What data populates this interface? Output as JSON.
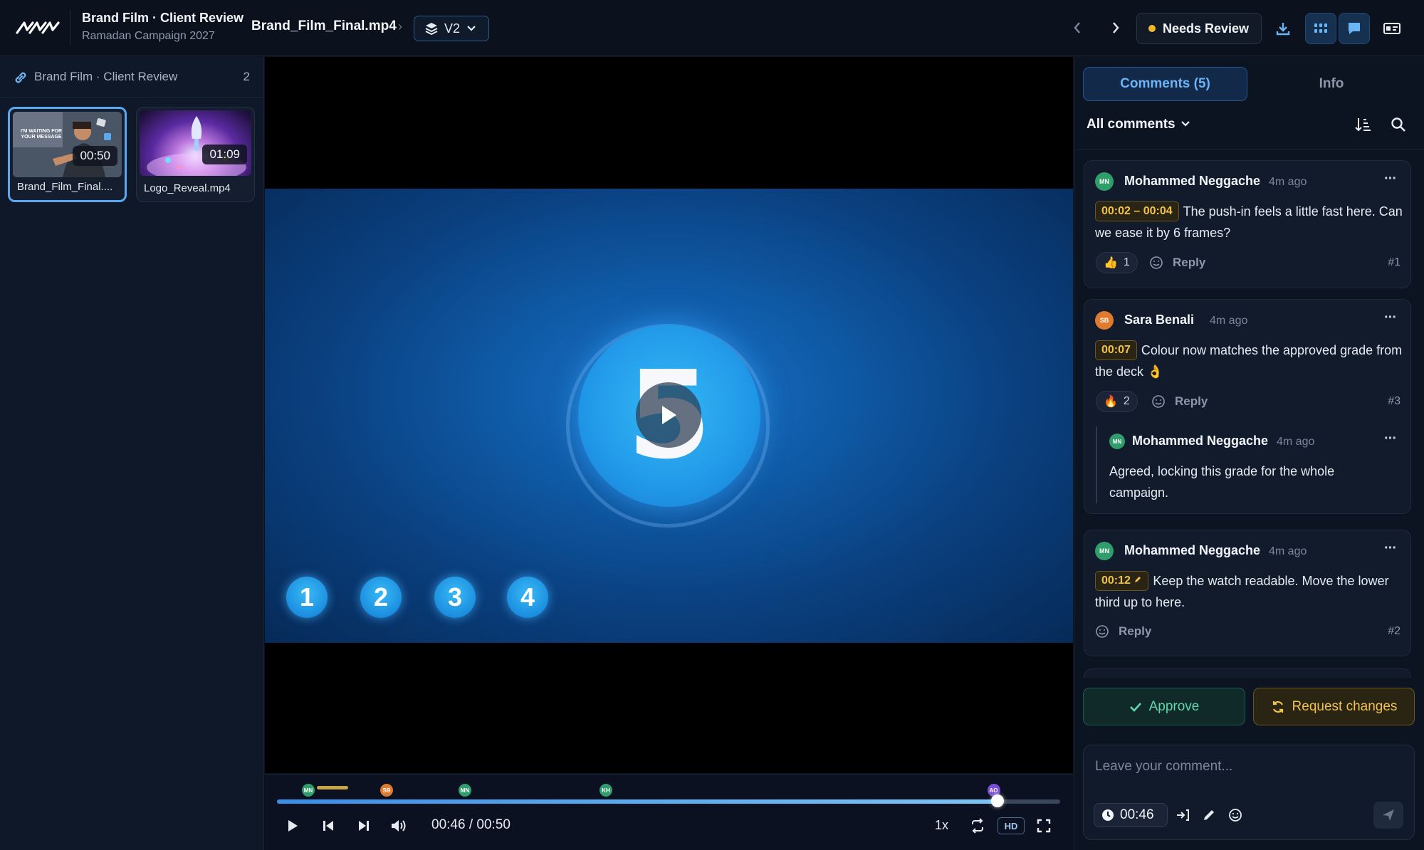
{
  "header": {
    "project_title": "Brand Film · Client Review",
    "project_subtitle": "Ramadan Campaign 2027",
    "file_name": "Brand_Film_Final.mp4",
    "version_label": "V2",
    "status_label": "Needs Review",
    "status_color": "#f2b824"
  },
  "sidebar": {
    "title": "Brand Film · Client Review",
    "count": "2",
    "items": [
      {
        "name": "Brand_Film_Final....",
        "duration": "00:50",
        "thumb_text": "I'M WAITING FOR YOUR MESSAGE",
        "selected": true
      },
      {
        "name": "Logo_Reveal.mp4",
        "duration": "01:09",
        "selected": false
      }
    ]
  },
  "video": {
    "big_number": "5",
    "small_numbers": [
      "1",
      "2",
      "3",
      "4"
    ]
  },
  "player": {
    "time_display": "00:46 / 00:50",
    "progress_fraction": 0.92,
    "speed": "1x",
    "quality": "HD",
    "markers": [
      {
        "initials": "MN",
        "color": "#2f9e6a",
        "time_fraction": 0.04
      },
      {
        "initials": "SB",
        "color": "#e07a2e",
        "time_fraction": 0.14
      },
      {
        "initials": "MN",
        "color": "#2f9e6a",
        "time_fraction": 0.24
      },
      {
        "initials": "KH",
        "color": "#2f9e6a",
        "time_fraction": 0.42
      },
      {
        "initials": "AO",
        "color": "#7a4fd6",
        "time_fraction": 0.915
      }
    ]
  },
  "panel": {
    "tab_comments": "Comments (5)",
    "tab_info": "Info",
    "filter_label": "All comments",
    "comments": [
      {
        "initials": "MN",
        "author": "Mohammed Neggache",
        "ago": "4m ago",
        "timestamp": "00:02 – 00:04",
        "text": "The push-in feels a little fast here. Can we ease it by 6 frames?",
        "reaction_emoji": "👍",
        "reaction_count": "1",
        "reply_label": "Reply",
        "number": "#1"
      },
      {
        "initials": "SB",
        "author": "Sara Benali",
        "ago": "4m ago",
        "timestamp": "00:07",
        "text": "Colour now matches the approved grade from the deck 👌",
        "reaction_emoji": "🔥",
        "reaction_count": "2",
        "reply_label": "Reply",
        "number": "#3",
        "reply": {
          "initials": "MN",
          "author": "Mohammed Neggache",
          "ago": "4m ago",
          "text": "Agreed, locking this grade for the whole campaign."
        }
      },
      {
        "initials": "MN",
        "author": "Mohammed Neggache",
        "ago": "4m ago",
        "timestamp": "00:12",
        "text": "Keep the watch readable. Move the lower third up to here.",
        "reply_label": "Reply",
        "number": "#2"
      }
    ],
    "approve_label": "Approve",
    "request_changes_label": "Request changes",
    "composer": {
      "placeholder": "Leave your comment...",
      "timestamp": "00:46"
    }
  }
}
